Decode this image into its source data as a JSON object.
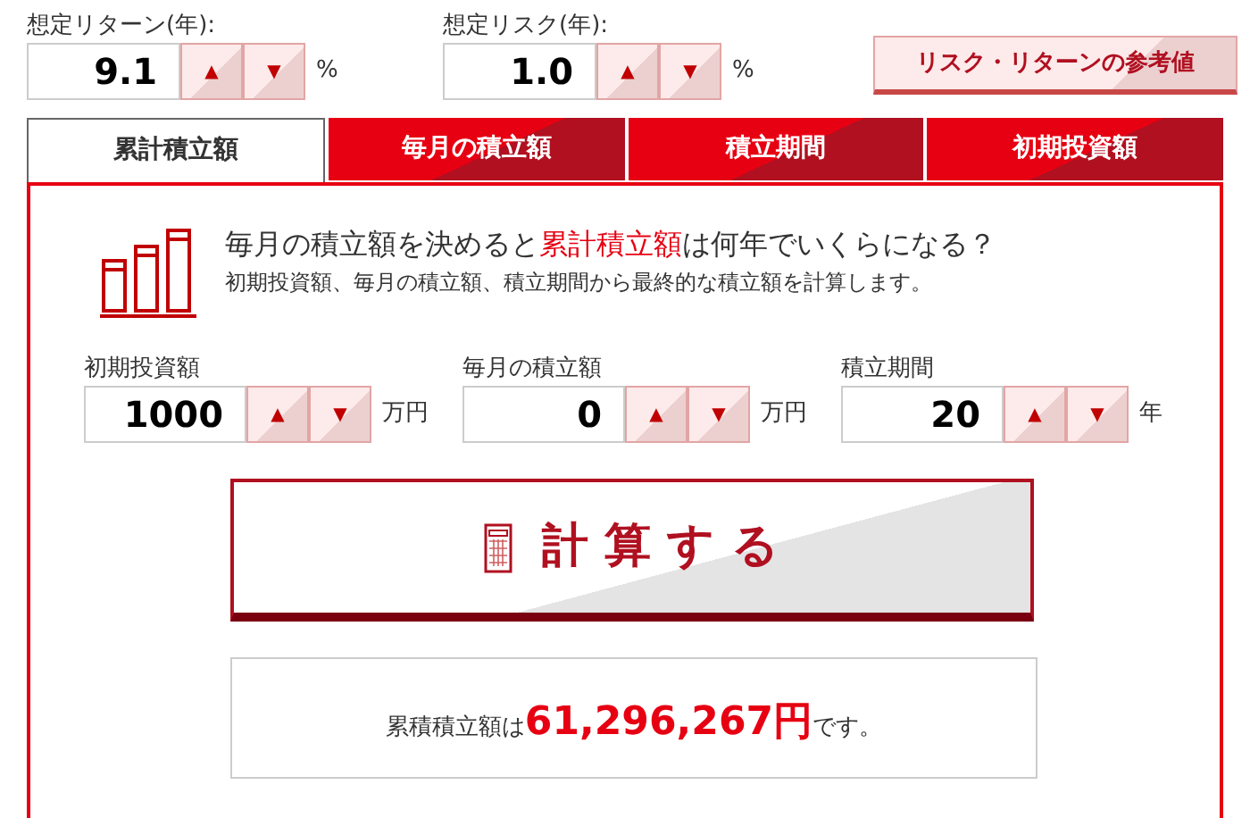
{
  "top_fields": [
    {
      "label": "想定リターン(年):",
      "value": "9.1",
      "up": "▲",
      "down": "▼",
      "unit": "%"
    },
    {
      "label": "想定リスク(年):",
      "value": "1.0",
      "up": "▲",
      "down": "▼",
      "unit": "%"
    }
  ],
  "reference_button": "リスク・リターンの参考値",
  "tabs": [
    {
      "label": "累計積立額",
      "selected": true
    },
    {
      "label": "毎月の積立額",
      "selected": false
    },
    {
      "label": "積立期間",
      "selected": false
    },
    {
      "label": "初期投資額",
      "selected": false
    }
  ],
  "heading": {
    "before": "毎月の積立額を決めると",
    "highlight": "累計積立額",
    "after": "は何年でいくらになる？"
  },
  "description": "初期投資額、毎月の積立額、積立期間から最終的な積立額を計算します。",
  "inputs": [
    {
      "label": "初期投資額",
      "value": "1000",
      "up": "▲",
      "down": "▼",
      "unit": "万円"
    },
    {
      "label": "毎月の積立額",
      "value": "0",
      "up": "▲",
      "down": "▼",
      "unit": "万円"
    },
    {
      "label": "積立期間",
      "value": "20",
      "up": "▲",
      "down": "▼",
      "unit": "年"
    }
  ],
  "calculate_button": "計 算 す る",
  "result": {
    "prefix": "累積積立額は",
    "amount": "61,296,267円",
    "suffix": "です。"
  }
}
